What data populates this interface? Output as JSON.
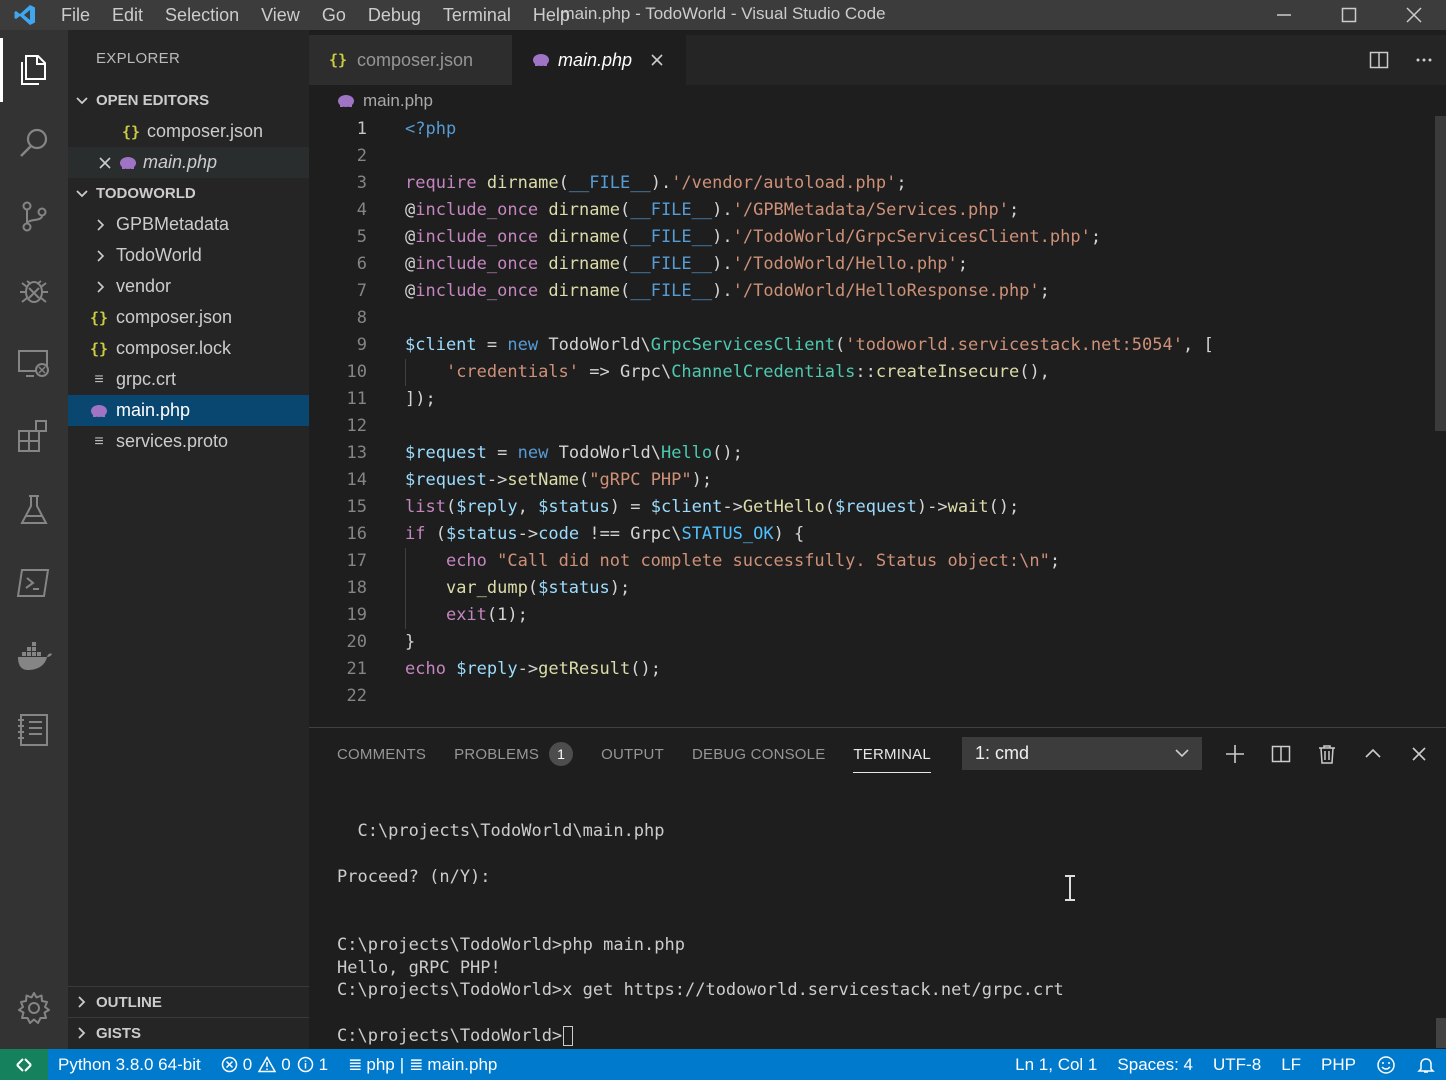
{
  "window": {
    "title": "main.php - TodoWorld - Visual Studio Code",
    "menu": [
      "File",
      "Edit",
      "Selection",
      "View",
      "Go",
      "Debug",
      "Terminal",
      "Help"
    ]
  },
  "activity_bar": [
    "explorer-icon",
    "search-icon",
    "source-control-icon",
    "debug-icon",
    "remote-explorer-icon",
    "extensions-icon",
    "test-icon",
    "terminal-icon",
    "docker-icon",
    "notebook-icon",
    "settings-gear-icon"
  ],
  "sidebar": {
    "title": "EXPLORER",
    "open_editors": {
      "label": "OPEN EDITORS",
      "items": [
        {
          "name": "composer.json",
          "icon": "json-icon"
        },
        {
          "name": "main.php",
          "icon": "php-icon"
        }
      ]
    },
    "project": {
      "label": "TODOWORLD",
      "items": [
        {
          "name": "GPBMetadata",
          "type": "folder"
        },
        {
          "name": "TodoWorld",
          "type": "folder"
        },
        {
          "name": "vendor",
          "type": "folder"
        },
        {
          "name": "composer.json",
          "type": "json"
        },
        {
          "name": "composer.lock",
          "type": "json"
        },
        {
          "name": "grpc.crt",
          "type": "text"
        },
        {
          "name": "main.php",
          "type": "php"
        },
        {
          "name": "services.proto",
          "type": "text"
        }
      ]
    },
    "outline_label": "OUTLINE",
    "gists_label": "GISTS"
  },
  "tabs": [
    {
      "label": "composer.json",
      "icon": "json-icon",
      "active": false
    },
    {
      "label": "main.php",
      "icon": "php-icon",
      "active": true
    }
  ],
  "breadcrumb": "main.php",
  "code_lines": [
    "<?php",
    "",
    "require dirname(__FILE__).'/vendor/autoload.php';",
    "@include_once dirname(__FILE__).'/GPBMetadata/Services.php';",
    "@include_once dirname(__FILE__).'/TodoWorld/GrpcServicesClient.php';",
    "@include_once dirname(__FILE__).'/TodoWorld/Hello.php';",
    "@include_once dirname(__FILE__).'/TodoWorld/HelloResponse.php';",
    "",
    "$client = new TodoWorld\\GrpcServicesClient('todoworld.servicestack.net:5054', [",
    "    'credentials' => Grpc\\ChannelCredentials::createInsecure(),",
    "]);",
    "",
    "$request = new TodoWorld\\Hello();",
    "$request->setName(\"gRPC PHP\");",
    "list($reply, $status) = $client->GetHello($request)->wait();",
    "if ($status->code !== Grpc\\STATUS_OK) {",
    "    echo \"Call did not complete successfully. Status object:\\n\";",
    "    var_dump($status);",
    "    exit(1);",
    "}",
    "echo $reply->getResult();",
    ""
  ],
  "panel": {
    "tabs": [
      "COMMENTS",
      "PROBLEMS",
      "OUTPUT",
      "DEBUG CONSOLE",
      "TERMINAL"
    ],
    "problems_count": "1",
    "active_tab": "TERMINAL",
    "terminal_selected": "1: cmd",
    "terminal_lines": [
      "  C:\\projects\\TodoWorld\\main.php",
      "Proceed? (n/Y):",
      "C:\\projects\\TodoWorld>php main.php",
      "Hello, gRPC PHP!",
      "C:\\projects\\TodoWorld>x get https://todoworld.servicestack.net/grpc.crt",
      "C:\\projects\\TodoWorld>"
    ]
  },
  "statusbar": {
    "python": "Python 3.8.0 64-bit",
    "errors": "0",
    "warnings": "0",
    "infos": "1",
    "language_file": "php",
    "current_file": "main.php",
    "position": "Ln 1, Col 1",
    "spaces": "Spaces: 4",
    "encoding": "UTF-8",
    "eol": "LF",
    "language": "PHP"
  },
  "colors": {
    "statusbar": "#007acc",
    "remote": "#16825d",
    "selection": "#094771"
  }
}
